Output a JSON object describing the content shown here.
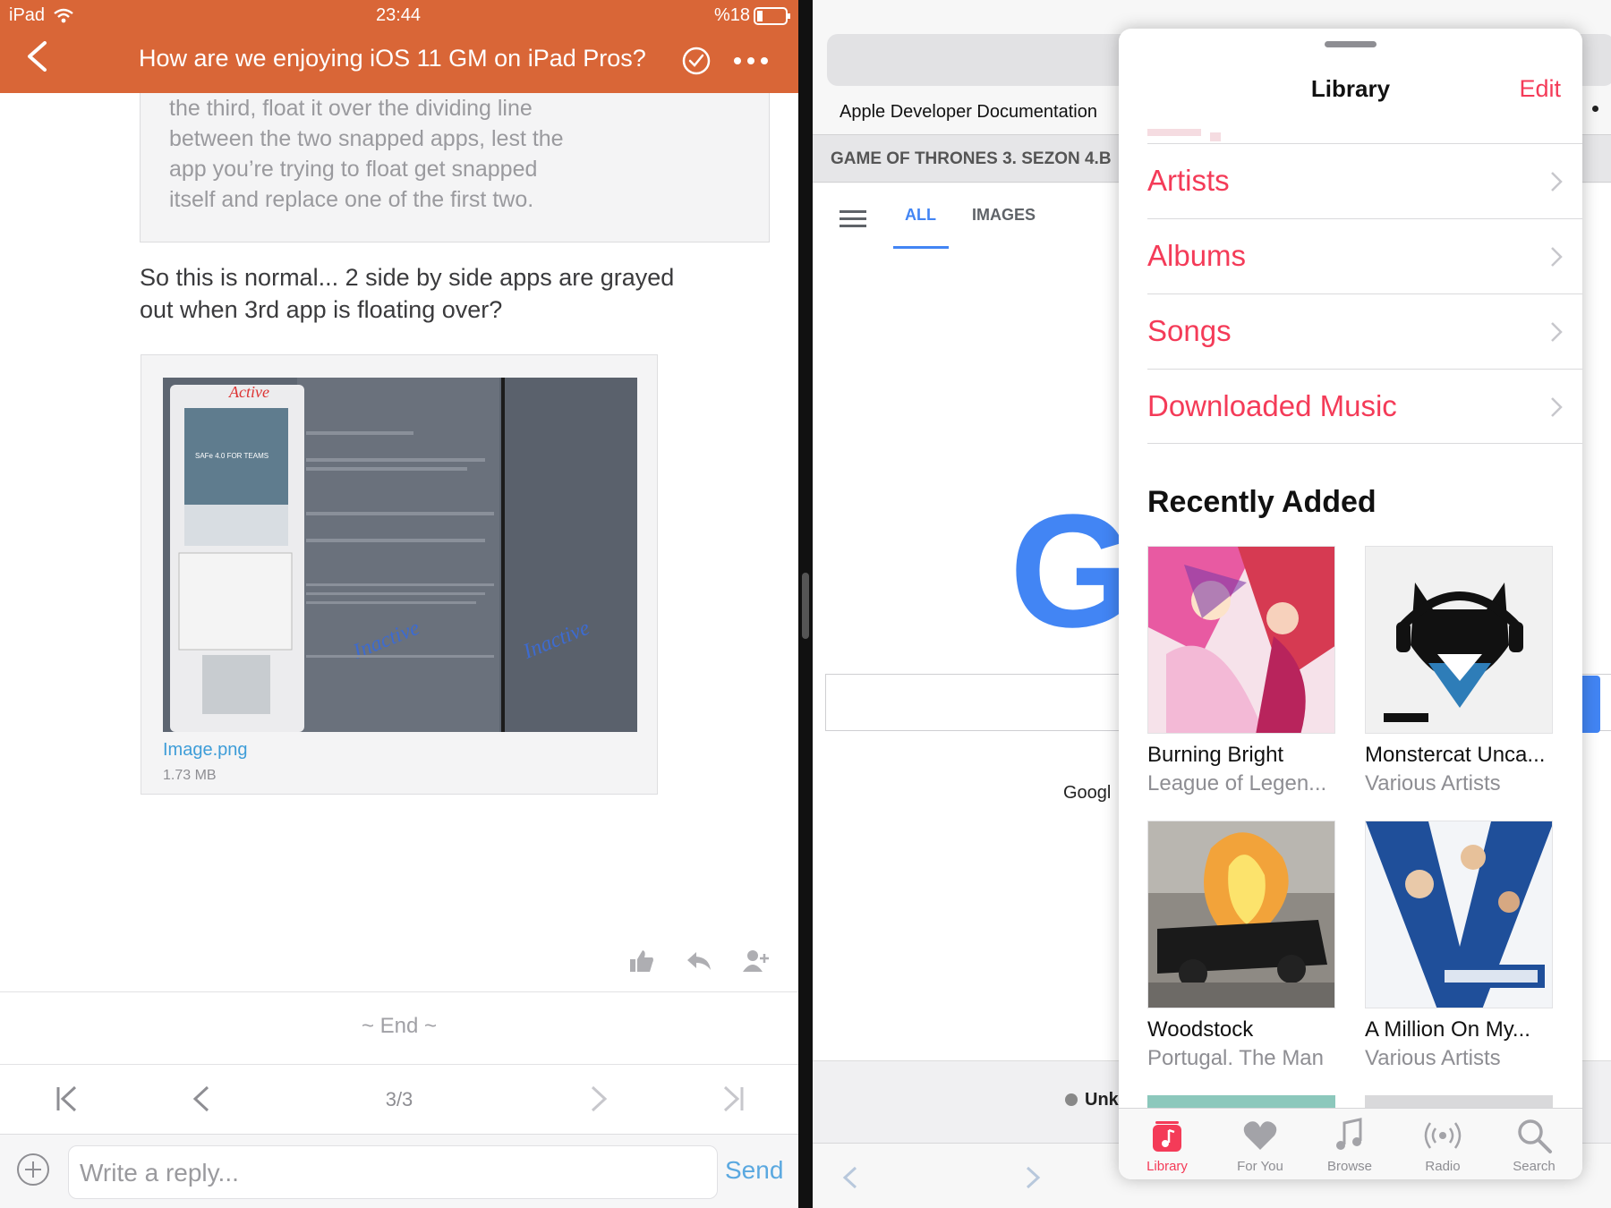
{
  "status_bar": {
    "device": "iPad",
    "time": "23:44",
    "battery": "%18"
  },
  "thread": {
    "title": "How are we enjoying iOS 11 GM on iPad Pros?",
    "quote_lines": [
      "the third, float it over the dividing line",
      "between the two snapped apps, lest the",
      "app you’re trying to float get snapped",
      "itself and replace one of the first two."
    ],
    "post_text": "So this is normal... 2 side by side apps are grayed out when 3rd app is floating over?",
    "attachment": {
      "name": "Image.png",
      "size": "1.73 MB"
    },
    "end_label": "~ End ~",
    "page_label": "3/3",
    "reply_placeholder": "Write a reply...",
    "send_label": "Send"
  },
  "browser": {
    "bookmark_title": "Apple Developer Documentation",
    "tab_title": "GAME OF THRONES 3. SEZON 4.B",
    "tabs": [
      "ALL",
      "IMAGES"
    ],
    "logo_letter": "G",
    "footer_text": "Googl",
    "location_text": "Unk"
  },
  "music": {
    "title": "Library",
    "edit_label": "Edit",
    "rows": [
      "Artists",
      "Albums",
      "Songs",
      "Downloaded Music"
    ],
    "recently_added_title": "Recently Added",
    "albums": [
      {
        "title": "Burning Bright",
        "artist": "League of Legen..."
      },
      {
        "title": "Monstercat Unca...",
        "artist": "Various Artists"
      },
      {
        "title": "Woodstock",
        "artist": "Portugal. The Man"
      },
      {
        "title": "A Million On My...",
        "artist": "Various Artists"
      }
    ],
    "tabbar": [
      "Library",
      "For You",
      "Browse",
      "Radio",
      "Search"
    ],
    "active_tab": "Library"
  },
  "colors": {
    "forum_orange": "#D96637",
    "music_pink": "#F43B58",
    "link_blue": "#3E9DD8",
    "google_blue": "#4285F4"
  },
  "icons": [
    "back-chevron-icon",
    "checkmark-circle-icon",
    "more-dots-icon",
    "like-icon",
    "reply-icon",
    "add-user-icon",
    "first-page-icon",
    "prev-page-icon",
    "next-page-icon",
    "last-page-icon",
    "plus-circle-icon",
    "chevron-right-icon",
    "music-note-icon",
    "heart-icon",
    "radio-waves-icon",
    "search-icon"
  ]
}
